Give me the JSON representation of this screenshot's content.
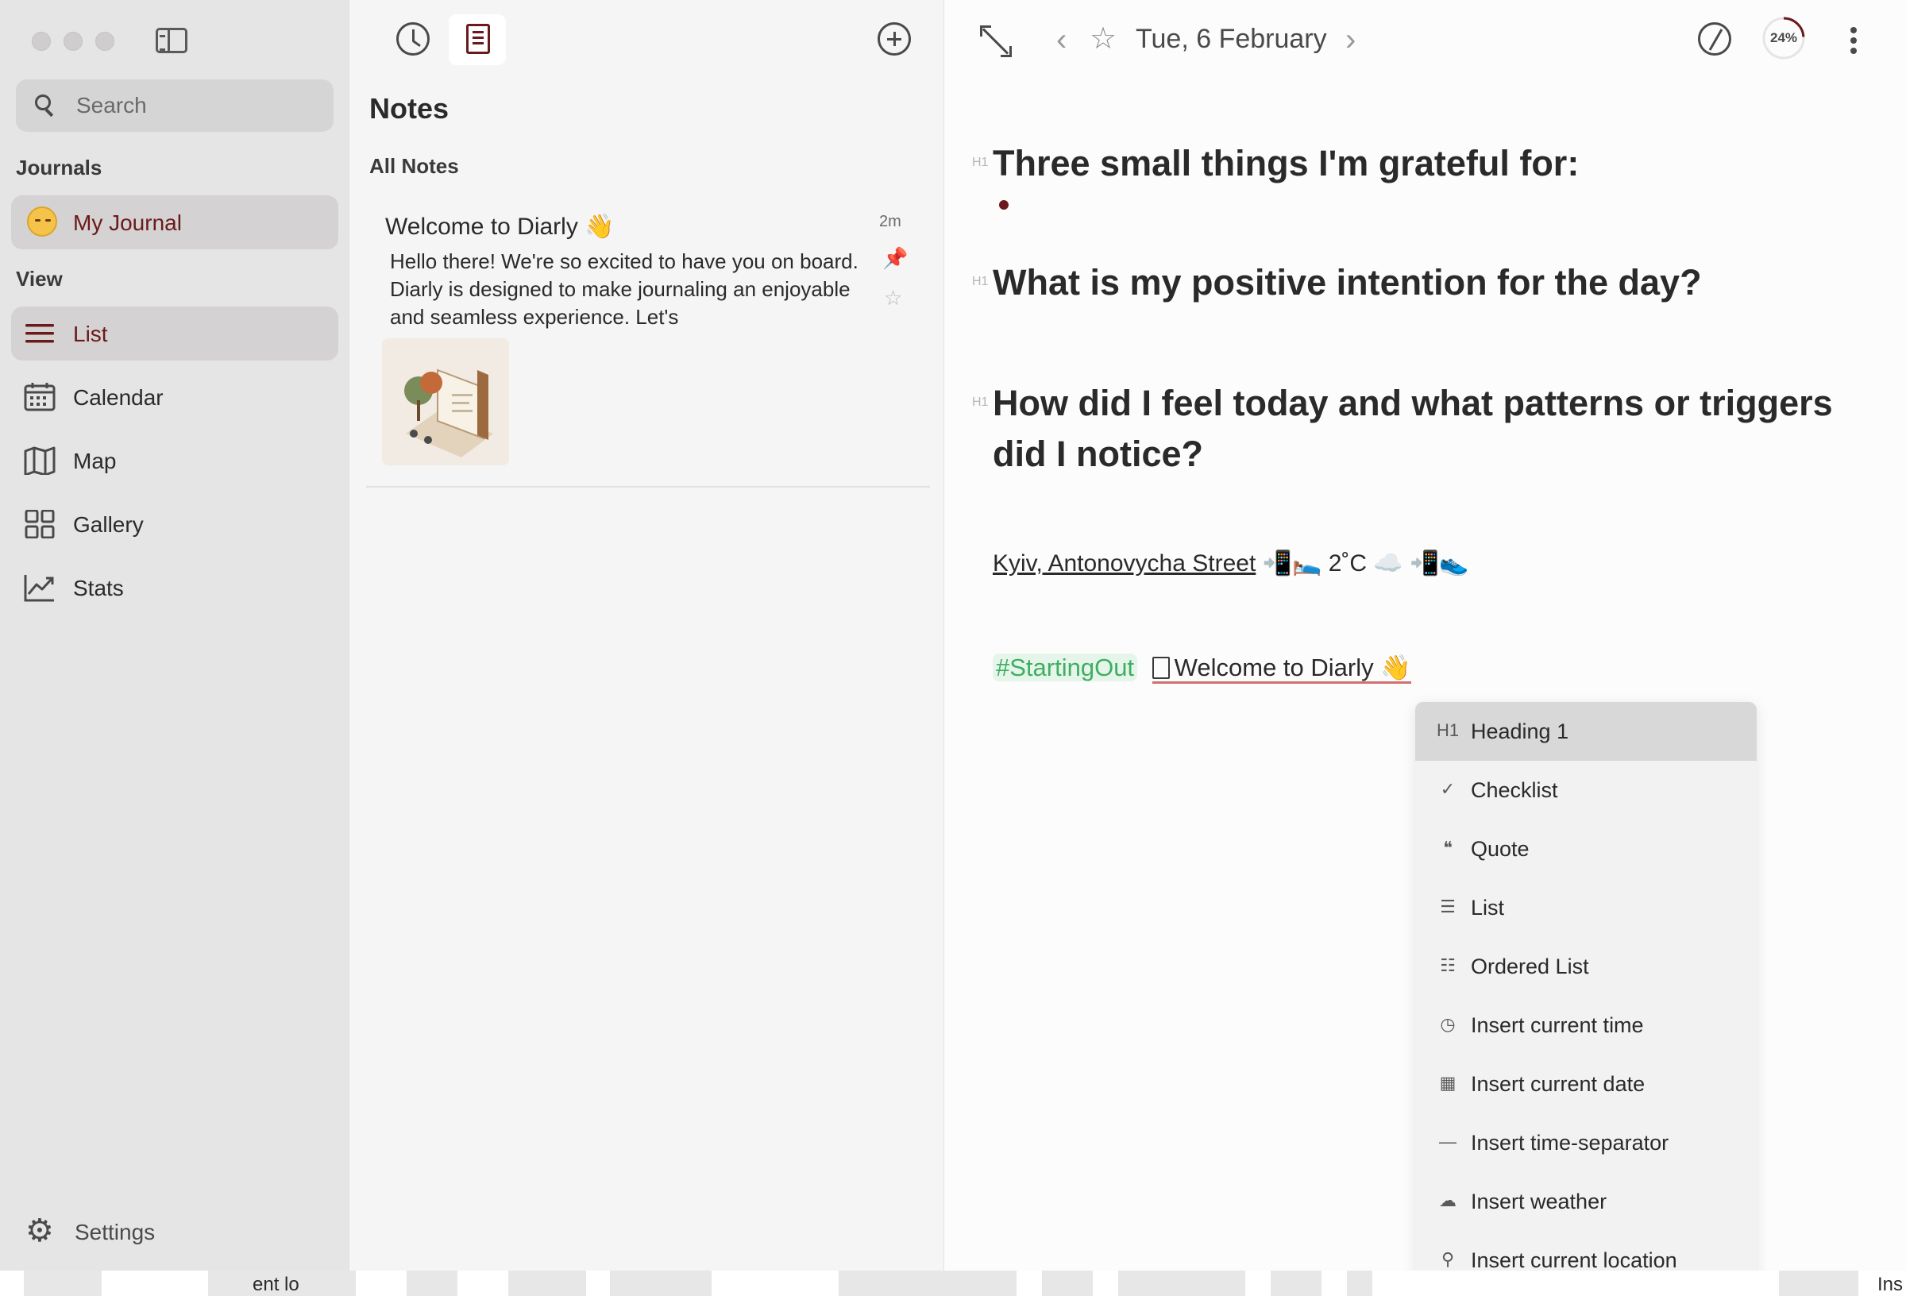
{
  "sidebar": {
    "search": {
      "placeholder": "Search"
    },
    "journals_label": "Journals",
    "journal_item": {
      "label": "My Journal",
      "icon": "relieved-face-emoji"
    },
    "view_label": "View",
    "items": [
      {
        "label": "List",
        "icon": "list-icon",
        "selected": true
      },
      {
        "label": "Calendar",
        "icon": "calendar-icon",
        "selected": false
      },
      {
        "label": "Map",
        "icon": "map-icon",
        "selected": false
      },
      {
        "label": "Gallery",
        "icon": "gallery-icon",
        "selected": false
      },
      {
        "label": "Stats",
        "icon": "stats-icon",
        "selected": false
      }
    ],
    "settings_label": "Settings"
  },
  "notes_panel": {
    "title": "Notes",
    "filter_label": "All Notes",
    "notes": [
      {
        "title": "Welcome to Diarly 👋",
        "time": "2m",
        "excerpt": "Hello there! We're so excited to have you on board. Diarly is designed to make journaling an enjoyable and seamless experience. Let's"
      }
    ]
  },
  "editor": {
    "date": "Tue, 6 February",
    "progress": {
      "text": "24%",
      "value": 0.24
    },
    "headings": [
      {
        "marker": "H1",
        "text": "Three small things I'm grateful for:"
      },
      {
        "marker": "H1",
        "text": "What is my positive intention for the day?"
      },
      {
        "marker": "H1",
        "text": "How did I feel today and what patterns or triggers did I notice?"
      }
    ],
    "location": "Kyiv, Antonovycha Street",
    "context_icons_before": "📲🛌",
    "temperature": "2˚C",
    "context_icons_after": "☁️ 📲👟",
    "tag": "#StartingOut",
    "linked_note": "Welcome to Diarly 👋"
  },
  "slash_menu": {
    "items": [
      {
        "label": "Heading 1",
        "icon": "H1",
        "active": true
      },
      {
        "label": "Checklist",
        "icon": "✓",
        "active": false
      },
      {
        "label": "Quote",
        "icon": "❝",
        "active": false
      },
      {
        "label": "List",
        "icon": "☰",
        "active": false
      },
      {
        "label": "Ordered List",
        "icon": "☷",
        "active": false
      },
      {
        "label": "Insert current time",
        "icon": "◷",
        "active": false
      },
      {
        "label": "Insert current date",
        "icon": "▦",
        "active": false
      },
      {
        "label": "Insert time-separator",
        "icon": "—",
        "active": false
      },
      {
        "label": "Insert weather",
        "icon": "☁",
        "active": false
      },
      {
        "label": "Insert current location",
        "icon": "⚲",
        "active": false
      }
    ]
  },
  "bottom_strip": {
    "fragment_a": "ent lo",
    "fragment_b": "Ins"
  },
  "colors": {
    "accent": "#6a1a1a",
    "tag_green": "#3fae62",
    "sidebar_bg": "#e6e5e5",
    "selected_bg": "#d4d2d2"
  }
}
